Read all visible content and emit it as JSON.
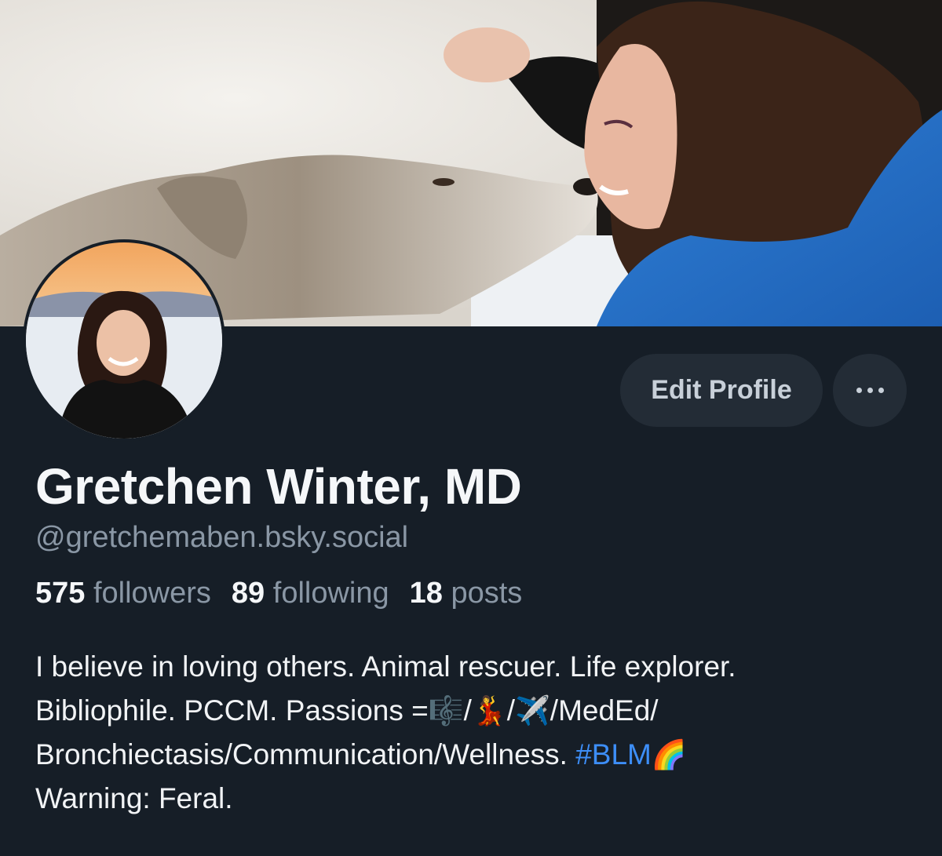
{
  "profile": {
    "display_name": "Gretchen Winter, MD",
    "handle": "@gretchemaben.bsky.social",
    "stats": {
      "followers_count": "575",
      "followers_label": "followers",
      "following_count": "89",
      "following_label": "following",
      "posts_count": "18",
      "posts_label": "posts"
    },
    "bio": {
      "line1": "I believe in loving others. Animal rescuer. Life explorer.",
      "line2_prefix": "Bibliophile. PCCM. Passions =",
      "emoji_music": "🎼",
      "sep1": "/",
      "emoji_dancer": "💃",
      "sep2": "/",
      "emoji_plane": "✈️",
      "line2_suffix": "/MedEd/",
      "line3_text": "Bronchiectasis/Communication/Wellness. ",
      "hashtag": "#BLM",
      "emoji_rainbow": "🌈",
      "line4": "Warning: Feral."
    }
  },
  "actions": {
    "edit_profile_label": "Edit Profile",
    "more_icon": "ellipsis-icon"
  },
  "colors": {
    "background": "#161e27",
    "button_bg": "#232c36",
    "muted_text": "#8a97a5",
    "hashtag": "#3d8ef7"
  }
}
